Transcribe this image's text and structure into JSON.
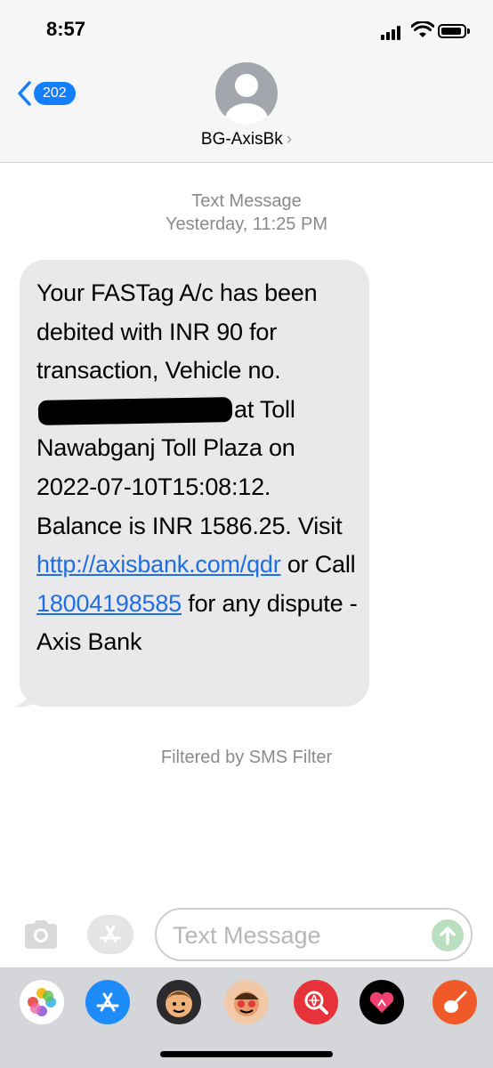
{
  "status_bar": {
    "time": "8:57"
  },
  "header": {
    "back_count": "202",
    "contact_name": "BG-AxisBk",
    "contact_chevron": "›"
  },
  "thread": {
    "service_label": "Text Message",
    "timestamp": "Yesterday, 11:25 PM",
    "message": {
      "part1": "Your FASTag A/c has been debited with INR 90 for transaction, Vehicle no.",
      "part2": "at Toll Nawabganj Toll Plaza on 2022-07-10T15:08:12. Balance is INR 1586.25. Visit ",
      "link_url": "http://axisbank.com/qdr",
      "part3": " or Call ",
      "link_phone": "18004198585",
      "part4": " for any dispute -Axis Bank"
    },
    "filter_note": "Filtered by SMS Filter"
  },
  "input": {
    "placeholder": "Text Message"
  },
  "dock_apps": [
    "photos-icon",
    "app-store-icon",
    "memoji-icon",
    "memoji-stickers-icon",
    "web-search-icon",
    "digital-touch-icon",
    "garageband-icon"
  ],
  "colors": {
    "accent": "#147efb",
    "link": "#1e6fe3",
    "bubble": "#e9e9eb",
    "meta_text": "#8a8a8e",
    "dock": "#d4d6da"
  }
}
